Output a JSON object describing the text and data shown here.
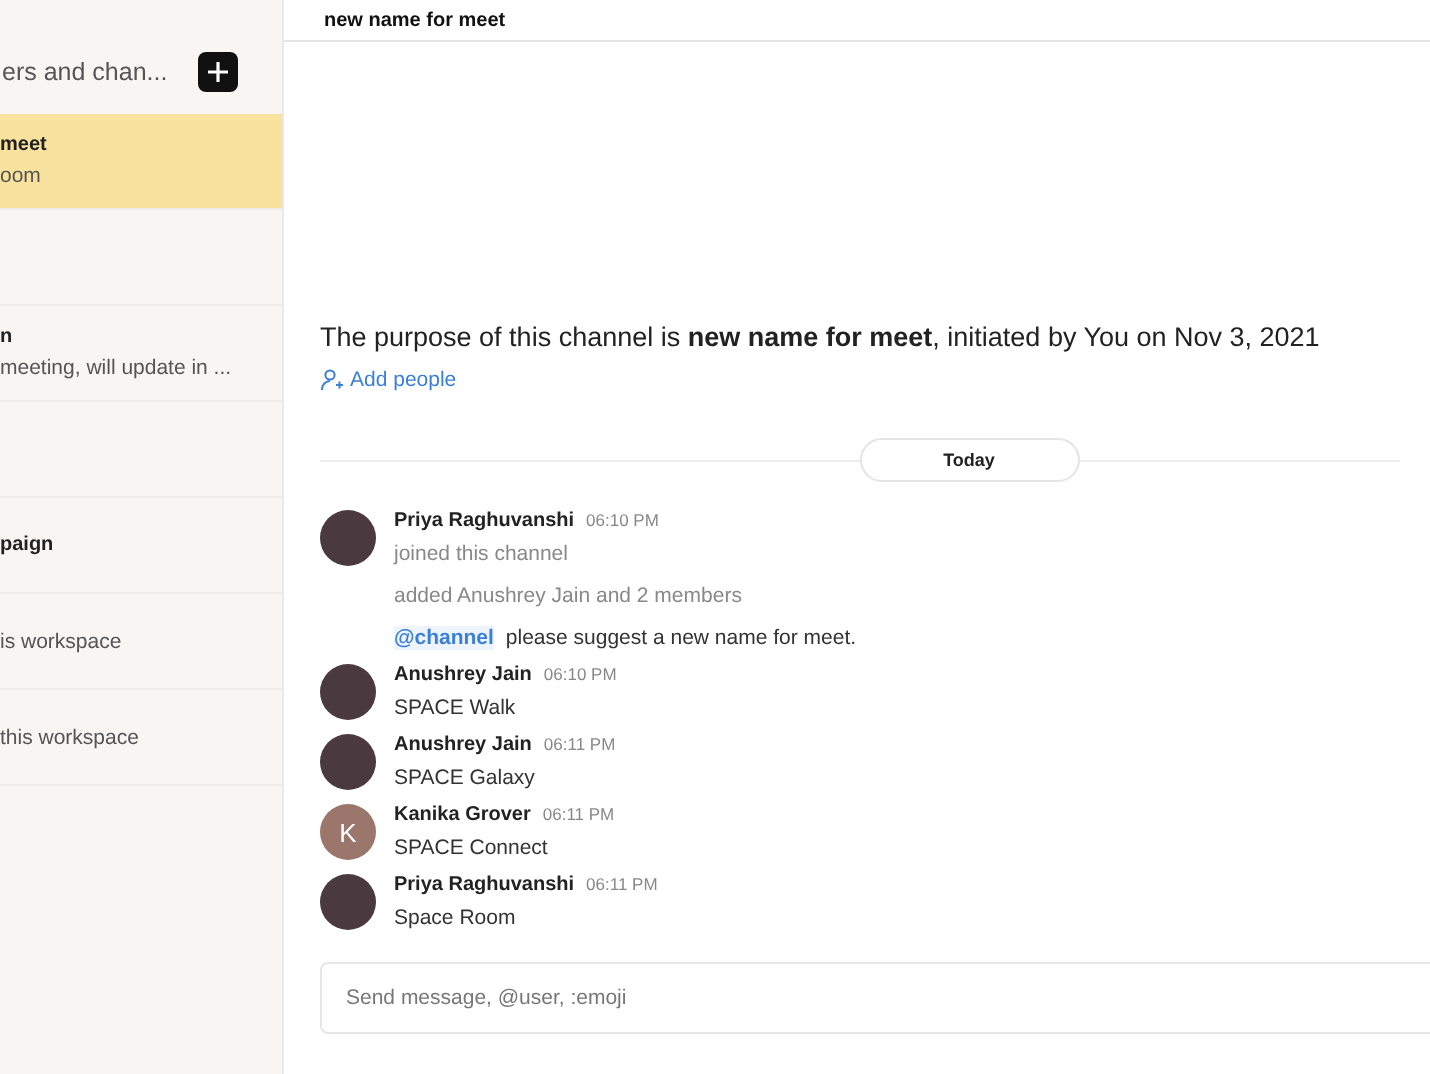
{
  "sidebar": {
    "search": {
      "placeholder": "ers and chan..."
    },
    "items": [
      {
        "name": "meet",
        "preview": "oom",
        "selected": true
      },
      {
        "selected": false
      },
      {
        "name": "n",
        "preview": "meeting, will update in ...",
        "selected": false
      },
      {
        "selected": false
      },
      {
        "name": "paign",
        "selected": false
      },
      {
        "preview": "is workspace",
        "selected": false
      },
      {
        "preview": " this workspace",
        "selected": false
      }
    ]
  },
  "header": {
    "title": "new name for meet"
  },
  "intro": {
    "text": "The purpose of this channel is **new name for meet**, initiated by You on Nov 3, 2021",
    "add_people": "Add people"
  },
  "divider": "Today",
  "messages": [
    {
      "kind": "photo",
      "name": "Priya Raghuvanshi",
      "time": "06:10 PM",
      "lines": [
        {
          "kind": "system",
          "text": "joined this channel"
        }
      ]
    },
    {
      "lines": [
        {
          "kind": "system",
          "text": "added Anushrey Jain and 2 members"
        }
      ]
    },
    {
      "lines": [
        {
          "kind": "mention",
          "mention": "@channel",
          "text": "please suggest a new name for meet."
        }
      ]
    },
    {
      "kind": "photo",
      "name": "Anushrey Jain",
      "time": "06:10 PM",
      "lines": [
        {
          "kind": "text",
          "text": "SPACE Walk"
        }
      ]
    },
    {
      "kind": "photo",
      "name": "Anushrey Jain",
      "time": "06:11 PM",
      "lines": [
        {
          "kind": "text",
          "text": "SPACE Galaxy"
        }
      ]
    },
    {
      "kind": "letter",
      "letter": "K",
      "name": "Kanika Grover",
      "time": "06:11 PM",
      "lines": [
        {
          "kind": "text",
          "text": "SPACE Connect"
        }
      ]
    },
    {
      "kind": "photo",
      "name": "Priya Raghuvanshi",
      "time": "06:11 PM",
      "lines": [
        {
          "kind": "text",
          "text": "Space Room"
        }
      ]
    }
  ],
  "composer": {
    "placeholder": "Send message, @user, :emoji"
  }
}
